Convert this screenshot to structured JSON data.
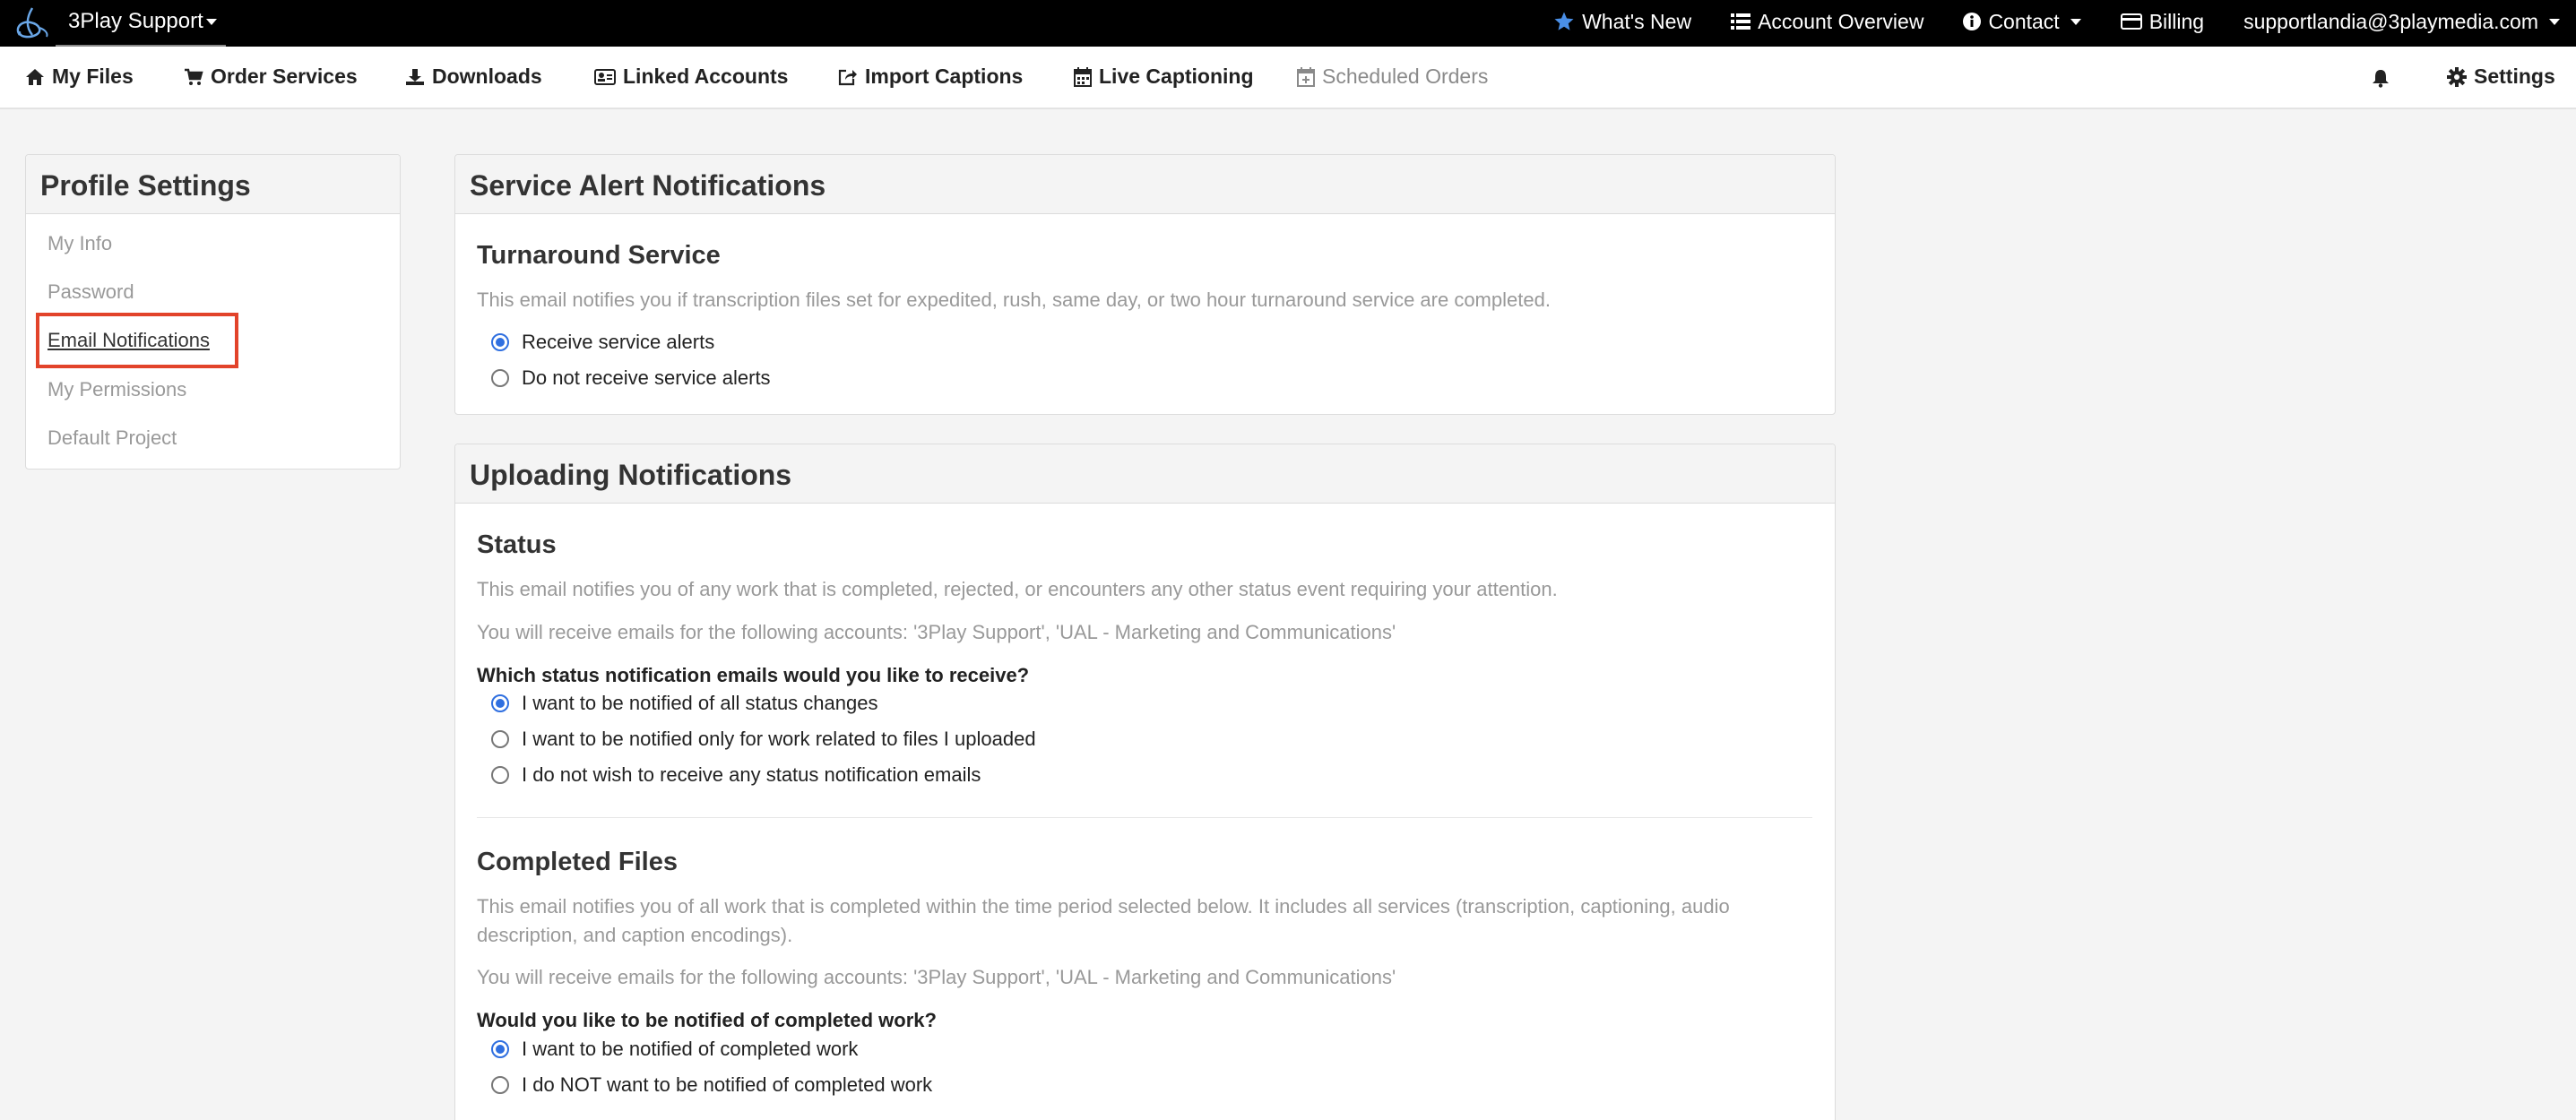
{
  "topbar": {
    "brand": "3Play Support",
    "whats_new": "What's New",
    "account_overview": "Account Overview",
    "contact": "Contact",
    "billing": "Billing",
    "user_email": "supportlandia@3playmedia.com"
  },
  "nav": {
    "my_files": "My Files",
    "order_services": "Order Services",
    "downloads": "Downloads",
    "linked_accounts": "Linked Accounts",
    "import_captions": "Import Captions",
    "live_captioning": "Live Captioning",
    "scheduled_orders": "Scheduled Orders",
    "settings": "Settings"
  },
  "sidebar": {
    "title": "Profile Settings",
    "items": [
      {
        "label": "My Info"
      },
      {
        "label": "Password"
      },
      {
        "label": "Email Notifications",
        "active": true
      },
      {
        "label": "My Permissions"
      },
      {
        "label": "Default Project"
      }
    ]
  },
  "service_alert": {
    "title": "Service Alert Notifications",
    "subtitle": "Turnaround Service",
    "description": "This email notifies you if transcription files set for expedited, rush, same day, or two hour turnaround service are completed.",
    "options": [
      {
        "label": "Receive service alerts",
        "checked": true
      },
      {
        "label": "Do not receive service alerts",
        "checked": false
      }
    ]
  },
  "uploading": {
    "title": "Uploading Notifications",
    "status": {
      "subtitle": "Status",
      "description": "This email notifies you of any work that is completed, rejected, or encounters any other status event requiring your attention.",
      "accounts": "You will receive emails for the following accounts: '3Play Support', 'UAL - Marketing and Communications'",
      "question": "Which status notification emails would you like to receive?",
      "options": [
        {
          "label": "I want to be notified of all status changes",
          "checked": true
        },
        {
          "label": "I want to be notified only for work related to files I uploaded",
          "checked": false
        },
        {
          "label": "I do not wish to receive any status notification emails",
          "checked": false
        }
      ]
    },
    "completed": {
      "subtitle": "Completed Files",
      "description_line1": "This email notifies you of all work that is completed within the time period selected below. It includes all services (transcription, captioning, audio",
      "description_line2": "description, and caption encodings).",
      "accounts": "You will receive emails for the following accounts: '3Play Support', 'UAL - Marketing and Communications'",
      "question": "Would you like to be notified of completed work?",
      "options": [
        {
          "label": "I want to be notified of completed work",
          "checked": true
        },
        {
          "label": "I do NOT want to be notified of completed work",
          "checked": false
        }
      ]
    }
  },
  "colors": {
    "accent": "#2f6fe0",
    "highlight": "#e2432a",
    "star": "#4a8fe7"
  }
}
